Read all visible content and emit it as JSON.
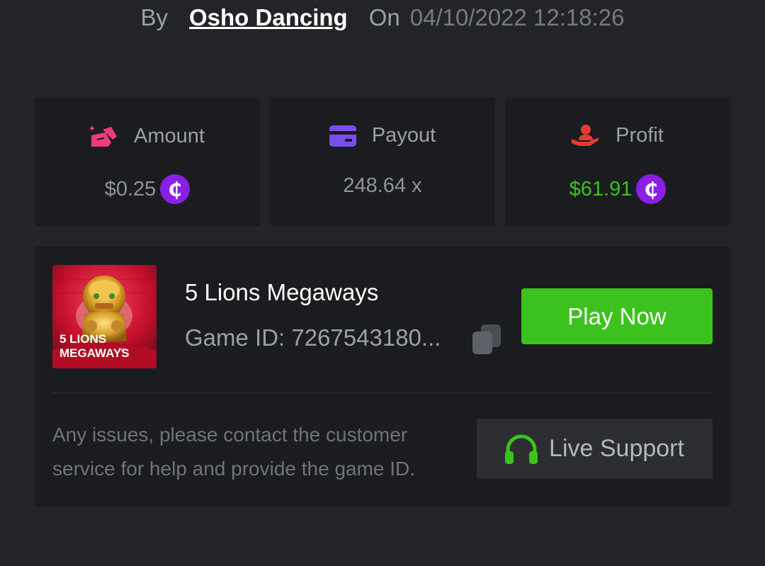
{
  "header": {
    "by_label": "By",
    "username": "Osho Dancing",
    "on_label": "On",
    "datetime": "04/10/2022 12:18:26"
  },
  "stats": {
    "amount": {
      "label": "Amount",
      "value": "$0.25",
      "icon": "bet-chips-icon",
      "coin_glyph": "₵"
    },
    "payout": {
      "label": "Payout",
      "value": "248.64 x",
      "icon": "credit-card-icon"
    },
    "profit": {
      "label": "Profit",
      "value": "$61.91",
      "icon": "hand-person-icon",
      "coin_glyph": "₵"
    }
  },
  "game": {
    "name": "5 Lions Megaways",
    "id_text": "Game ID: 7267543180...",
    "thumbnail": {
      "line1": "5 LIONS",
      "line2": "MEGAWAYS",
      "tm": "TM"
    },
    "play_label": "Play Now"
  },
  "support": {
    "help_text": "Any issues, please contact the customer service for help and provide the game ID.",
    "button_label": "Live Support"
  },
  "colors": {
    "accent_green": "#3cc21d",
    "coin_purple": "#8a1fe6",
    "amount_icon": "#ee3c7a",
    "payout_icon": "#7b4df0",
    "profit_icon": "#e53935"
  }
}
